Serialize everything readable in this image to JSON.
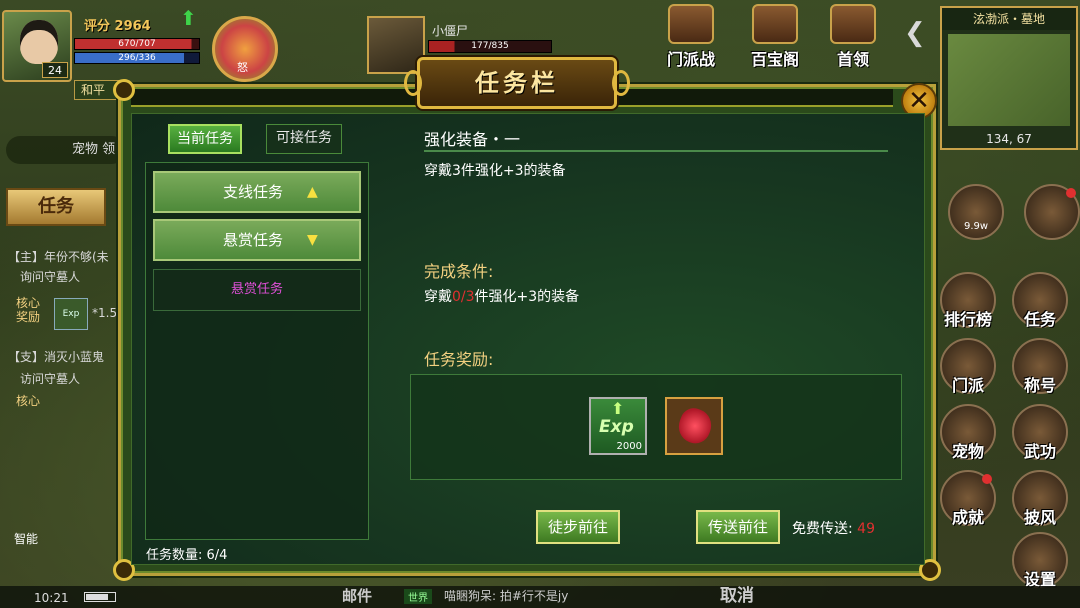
{
  "player": {
    "score_label": "评分",
    "score": "2964",
    "level": "24",
    "hp": "670/707",
    "mp": "296/336",
    "pk_mode": "和平"
  },
  "rage_label": "怒",
  "target": {
    "name": "小僵尸",
    "hp": "177/835"
  },
  "top_menus": [
    "门派战",
    "百宝阁",
    "首领"
  ],
  "minimap": {
    "title": "泫渤派・墓地",
    "coords": "134, 67"
  },
  "left_panel": {
    "pet_label": "宠物",
    "pet_suffix": "领",
    "quest_tab": "任务",
    "items": [
      "【主】年份不够(未",
      "询问守墓人",
      "【支】消灭小蓝鬼",
      "访问守墓人"
    ],
    "core_reward": "核心\n奖励",
    "core_short": "核心",
    "exp_qty": "*1.5",
    "exp_label": "Exp",
    "smart": "智能"
  },
  "bottom": {
    "time": "10:21",
    "mail": "邮件",
    "world_tag": "世界",
    "chat": "喵睏狗呆: 拍#行不是jy",
    "cancel": "取消"
  },
  "side_icons": [
    {
      "label": "",
      "sub": "9.9w"
    },
    {
      "label": ""
    },
    {
      "label": "排行榜"
    },
    {
      "label": "任务"
    },
    {
      "label": "门派"
    },
    {
      "label": "称号"
    },
    {
      "label": "宠物"
    },
    {
      "label": "武功"
    },
    {
      "label": "成就"
    },
    {
      "label": "披风"
    },
    {
      "label": "设置"
    }
  ],
  "dialog": {
    "title": "任务栏",
    "close": "✕",
    "tabs": {
      "current": "当前任务",
      "available": "可接任务"
    },
    "categories": [
      {
        "label": "支线任务",
        "arrow": "▲"
      },
      {
        "label": "悬赏任务",
        "arrow": "▼"
      }
    ],
    "sub_item": "悬赏任务",
    "quest_count": "任务数量: 6/4",
    "quest": {
      "title": "强化装备・一",
      "description": "穿戴3件强化+3的装备",
      "condition_title": "完成条件:",
      "condition_prefix": "穿戴",
      "condition_progress": "0/3",
      "condition_suffix": "件强化+3的装备",
      "reward_title": "任务奖励:",
      "rewards": [
        {
          "name": "Exp",
          "qty": "2000"
        },
        {
          "name": "red-gem",
          "qty": ""
        }
      ]
    },
    "buttons": {
      "walk": "徒步前往",
      "teleport": "传送前往"
    },
    "free_teleport_label": "免费传送: ",
    "free_teleport_count": "49"
  }
}
